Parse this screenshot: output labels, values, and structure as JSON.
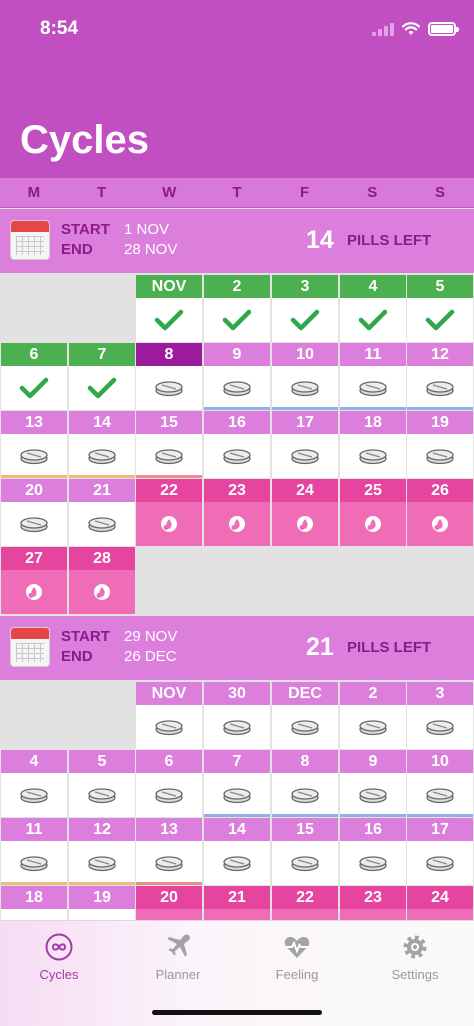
{
  "status": {
    "time": "8:54"
  },
  "header": {
    "title": "Cycles"
  },
  "weekdays": [
    "M",
    "T",
    "W",
    "T",
    "F",
    "S",
    "S"
  ],
  "cycles": [
    {
      "start_label": "START",
      "end_label": "END",
      "start": "1 NOV",
      "end": "28 NOV",
      "pills": "14",
      "pills_label": "PILLS LEFT",
      "days": [
        "NOV",
        "2",
        "3",
        "4",
        "5",
        "6",
        "7",
        "8",
        "9",
        "10",
        "11",
        "12",
        "13",
        "14",
        "15",
        "16",
        "17",
        "18",
        "19",
        "20",
        "21",
        "22",
        "23",
        "24",
        "25",
        "26",
        "27",
        "28"
      ]
    },
    {
      "start_label": "START",
      "end_label": "END",
      "start": "29 NOV",
      "end": "26 DEC",
      "pills": "21",
      "pills_label": "PILLS LEFT",
      "days": [
        "NOV",
        "30",
        "DEC",
        "2",
        "3",
        "4",
        "5",
        "6",
        "7",
        "8",
        "9",
        "10",
        "11",
        "12",
        "13",
        "14",
        "15",
        "16",
        "17",
        "18",
        "19",
        "20",
        "21",
        "22",
        "23",
        "24"
      ]
    }
  ],
  "tabs": [
    {
      "label": "Cycles",
      "icon": "infinity-icon"
    },
    {
      "label": "Planner",
      "icon": "airplane-icon"
    },
    {
      "label": "Feeling",
      "icon": "heart-pulse-icon"
    },
    {
      "label": "Settings",
      "icon": "gear-icon"
    }
  ],
  "colors": {
    "header": "#c14fc1",
    "taken": "#4caf50",
    "today": "#9c1a9c",
    "pill_day": "#dc7edc",
    "break_day": "#e6459f",
    "accent": "#a13aa8"
  }
}
